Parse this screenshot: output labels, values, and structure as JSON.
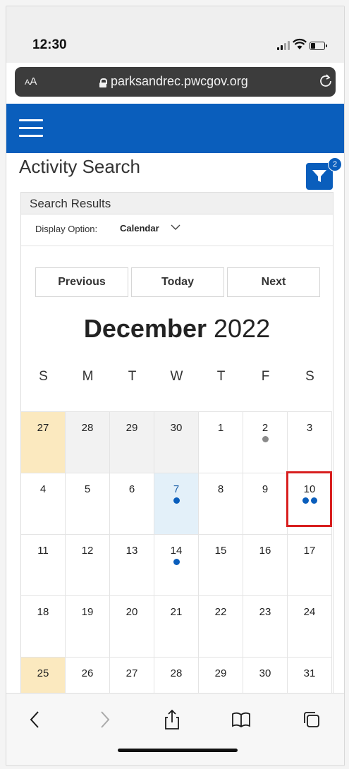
{
  "status": {
    "time": "12:30"
  },
  "browser": {
    "text_size": "AA",
    "url": "parksandrec.pwcgov.org"
  },
  "page": {
    "title": "Activity Search",
    "filter_count": "2"
  },
  "results": {
    "heading": "Search Results",
    "display_option_label": "Display Option:",
    "display_option_value": "Calendar"
  },
  "calendar": {
    "prev_label": "Previous",
    "today_label": "Today",
    "next_label": "Next",
    "month": "December",
    "year": "2022",
    "weekdays": [
      "S",
      "M",
      "T",
      "W",
      "T",
      "F",
      "S"
    ],
    "weeks": [
      [
        {
          "d": "27",
          "state": "today"
        },
        {
          "d": "28",
          "state": "prev"
        },
        {
          "d": "29",
          "state": "prev"
        },
        {
          "d": "30",
          "state": "prev"
        },
        {
          "d": "1"
        },
        {
          "d": "2",
          "dots": [
            "gray"
          ]
        },
        {
          "d": "3"
        }
      ],
      [
        {
          "d": "4"
        },
        {
          "d": "5"
        },
        {
          "d": "6"
        },
        {
          "d": "7",
          "state": "sel",
          "dots": [
            "blue"
          ]
        },
        {
          "d": "8"
        },
        {
          "d": "9"
        },
        {
          "d": "10",
          "dots": [
            "blue",
            "blue"
          ],
          "highlight": true
        }
      ],
      [
        {
          "d": "11"
        },
        {
          "d": "12"
        },
        {
          "d": "13"
        },
        {
          "d": "14",
          "dots": [
            "blue"
          ]
        },
        {
          "d": "15"
        },
        {
          "d": "16"
        },
        {
          "d": "17"
        }
      ],
      [
        {
          "d": "18"
        },
        {
          "d": "19"
        },
        {
          "d": "20"
        },
        {
          "d": "21"
        },
        {
          "d": "22"
        },
        {
          "d": "23"
        },
        {
          "d": "24"
        }
      ],
      [
        {
          "d": "25",
          "state": "today"
        },
        {
          "d": "26"
        },
        {
          "d": "27"
        },
        {
          "d": "28"
        },
        {
          "d": "29"
        },
        {
          "d": "30"
        },
        {
          "d": "31"
        }
      ]
    ]
  },
  "toolbar": {
    "icons": [
      "back-icon",
      "forward-icon",
      "share-icon",
      "bookmarks-icon",
      "tabs-icon"
    ]
  },
  "colors": {
    "brand_blue": "#0a5ebc",
    "today_bg": "#fbe9bf",
    "highlight_red": "#d81f1f"
  }
}
